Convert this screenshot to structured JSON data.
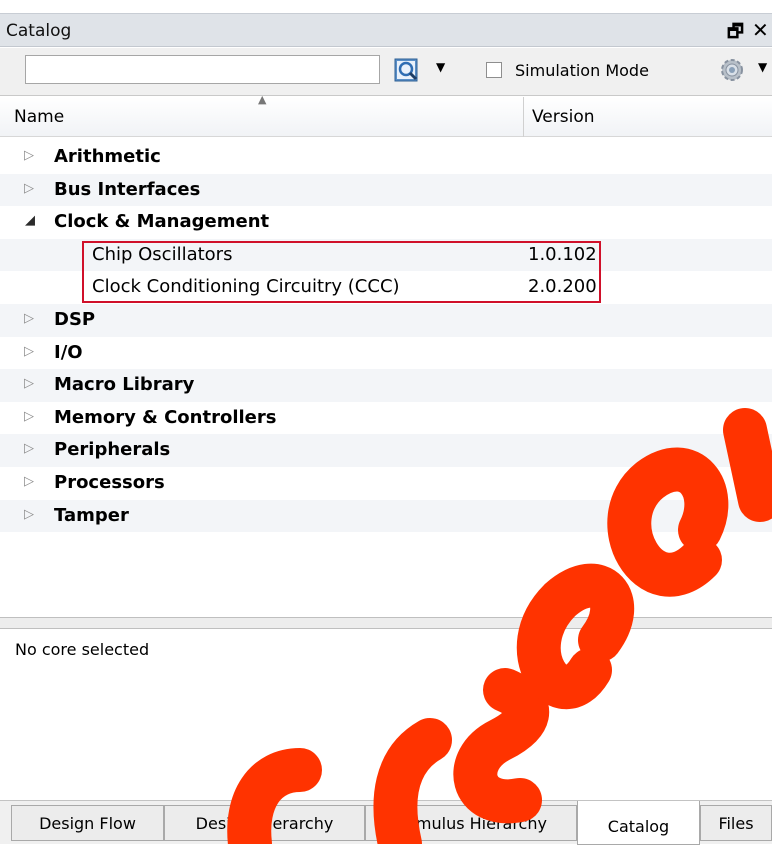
{
  "window": {
    "title": "Catalog",
    "restore_glyph": "🗗",
    "close_glyph": "✕"
  },
  "toolbar": {
    "search_value": "",
    "simulation_mode_label": "Simulation Mode",
    "simulation_mode_checked": false
  },
  "columns": {
    "name": "Name",
    "version": "Version"
  },
  "tree": [
    {
      "label": "Arithmetic",
      "expanded": false
    },
    {
      "label": "Bus Interfaces",
      "expanded": false
    },
    {
      "label": "Clock & Management",
      "expanded": true,
      "children": [
        {
          "label": "Chip Oscillators",
          "version": "1.0.102"
        },
        {
          "label": "Clock Conditioning Circuitry (CCC)",
          "version": "2.0.200"
        }
      ]
    },
    {
      "label": "DSP",
      "expanded": false
    },
    {
      "label": "I/O",
      "expanded": false
    },
    {
      "label": "Macro Library",
      "expanded": false
    },
    {
      "label": "Memory & Controllers",
      "expanded": false
    },
    {
      "label": "Peripherals",
      "expanded": false
    },
    {
      "label": "Processors",
      "expanded": false
    },
    {
      "label": "Tamper",
      "expanded": false
    }
  ],
  "details": {
    "text": "No core selected"
  },
  "tabs": [
    {
      "label": "Design Flow",
      "active": false
    },
    {
      "label": "Design Hierarchy",
      "active": false
    },
    {
      "label": "Stimulus Hierarchy",
      "active": false
    },
    {
      "label": "Catalog",
      "active": true
    },
    {
      "label": "Files",
      "active": false
    }
  ],
  "colors": {
    "highlight_border": "#d0102a",
    "watermark": "#ff3300"
  }
}
